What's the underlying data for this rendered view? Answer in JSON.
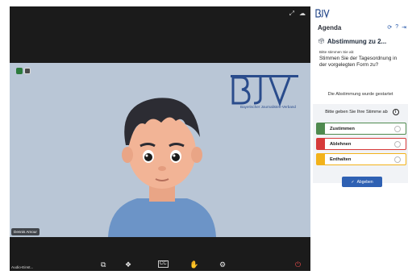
{
  "colors": {
    "accent": "#2f61b3",
    "zustimmen": "#4f8a4f",
    "ablehnen": "#d63a3a",
    "enthalten": "#f2b21a"
  },
  "video": {
    "participant_name": "Dennis Amour",
    "audio_label": "Audio-Einst...",
    "logo_sub": "Bayerischer Journalisten-Verband",
    "top_icons": [
      "expand-icon",
      "cloud-icon"
    ],
    "controls": [
      "share-screen-icon",
      "reactions-icon",
      "cc-icon",
      "raise-hand-icon",
      "settings-icon",
      "leave-icon"
    ]
  },
  "panel": {
    "agenda_title": "Agenda",
    "poll_title": "Abstimmung zu 2...",
    "prompt": "Bitte stimmen Sie ab:",
    "question": "Stimmen Sie der Tagesordnung in der vorgelegten Form zu?",
    "started": "Die Abstimmung wurde gestartet",
    "vote_heading": "Bitte geben Sie Ihre Stimme ab",
    "options": [
      {
        "label": "Zustimmen"
      },
      {
        "label": "Ablehnen"
      },
      {
        "label": "Enthalten"
      }
    ],
    "submit_label": "Abgeben"
  }
}
